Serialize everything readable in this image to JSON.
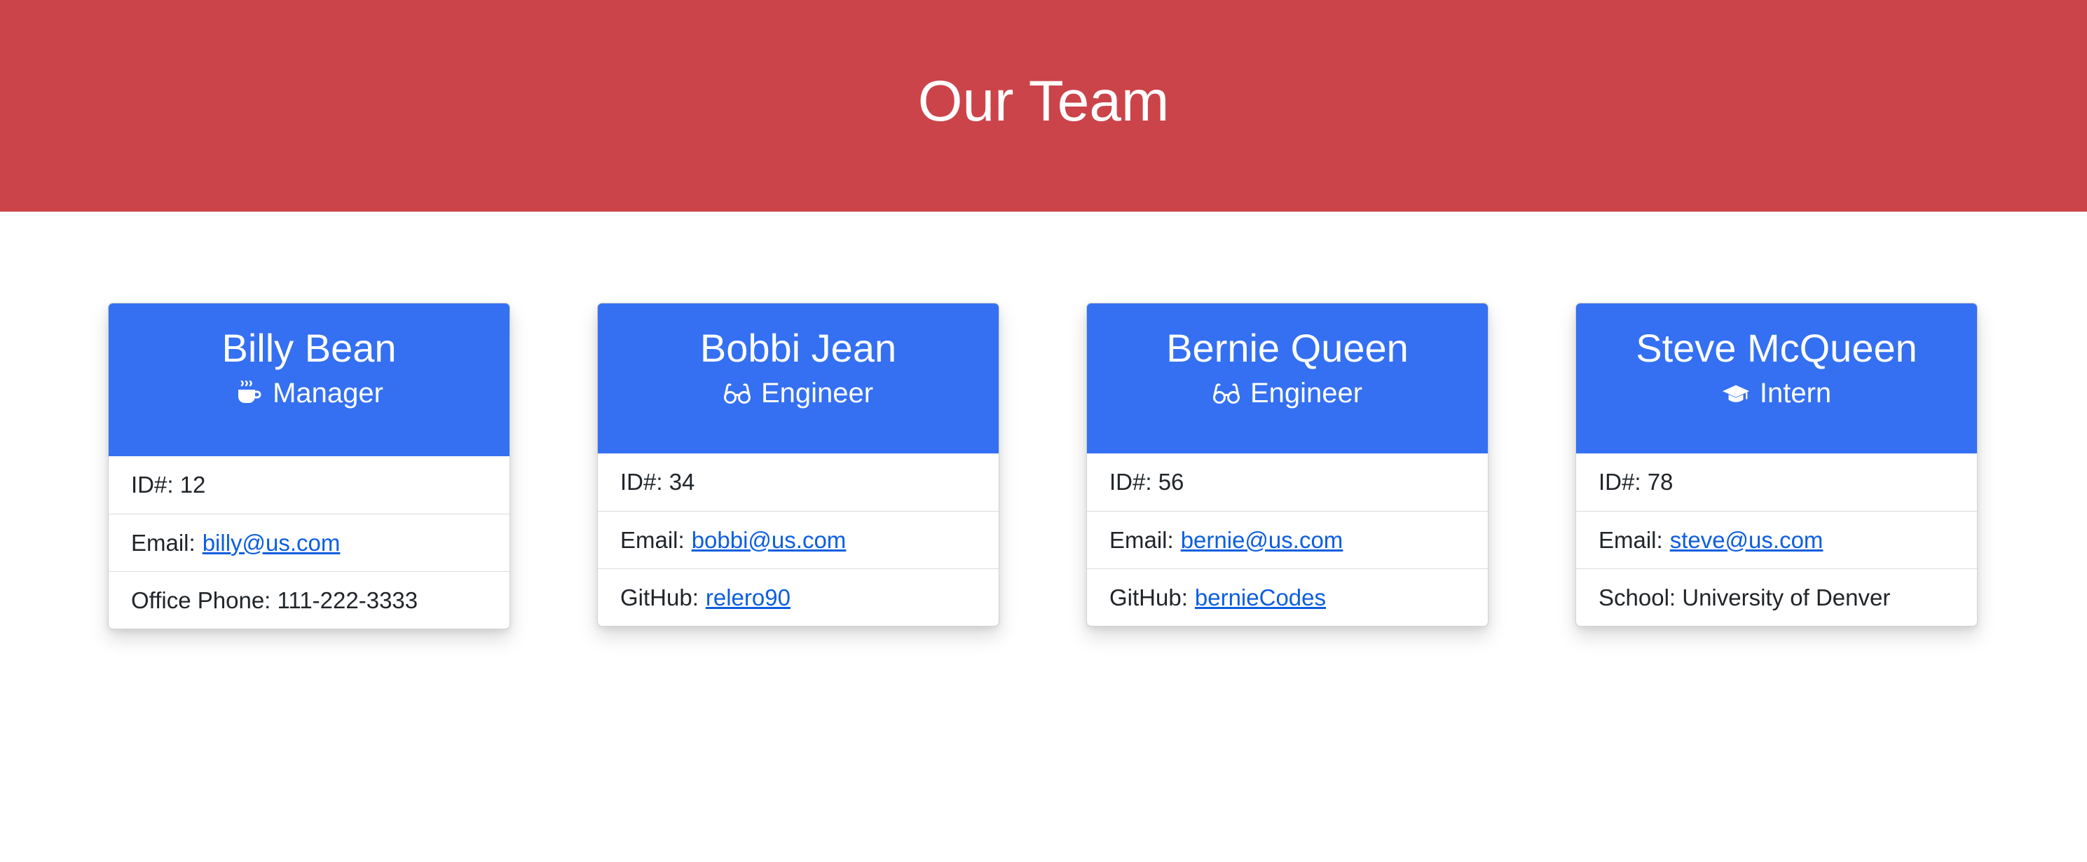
{
  "page": {
    "title": "Our Team"
  },
  "colors": {
    "header_bg": "#cb444a",
    "card_header_bg": "#3470f1",
    "link": "#0d5ee0"
  },
  "team": [
    {
      "name": "Billy Bean",
      "role": "Manager",
      "role_icon": "coffee-icon",
      "id_text": "ID#: 12",
      "email_label": "Email:",
      "email": "billy@us.com",
      "extra_label": "Office Phone: 111-222-3333",
      "extra_value": ""
    },
    {
      "name": "Bobbi Jean",
      "role": "Engineer",
      "role_icon": "glasses-icon",
      "id_text": "ID#: 34",
      "email_label": "Email:",
      "email": "bobbi@us.com",
      "extra_label": "GitHub:",
      "extra_value": "relero90"
    },
    {
      "name": "Bernie Queen",
      "role": "Engineer",
      "role_icon": "glasses-icon",
      "id_text": "ID#: 56",
      "email_label": "Email:",
      "email": "bernie@us.com",
      "extra_label": "GitHub:",
      "extra_value": "bernieCodes"
    },
    {
      "name": "Steve McQueen",
      "role": "Intern",
      "role_icon": "graduation-cap-icon",
      "id_text": "ID#: 78",
      "email_label": "Email:",
      "email": "steve@us.com",
      "extra_label": "School: University of Denver",
      "extra_value": ""
    }
  ]
}
